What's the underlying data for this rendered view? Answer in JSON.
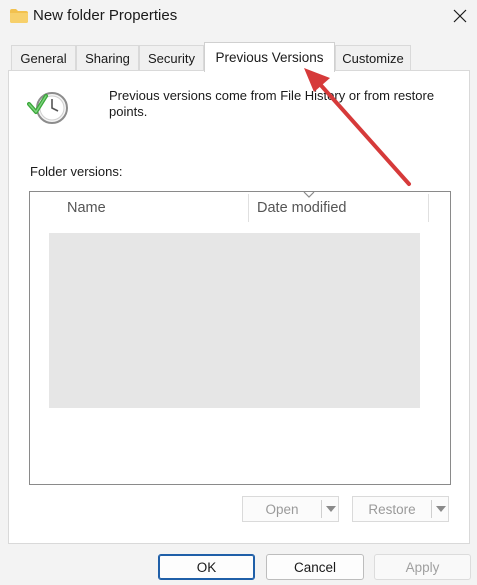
{
  "window": {
    "title": "New folder Properties",
    "icon": "folder-icon",
    "close_icon": "close-icon"
  },
  "tabs": [
    {
      "label": "General",
      "active": false
    },
    {
      "label": "Sharing",
      "active": false
    },
    {
      "label": "Security",
      "active": false
    },
    {
      "label": "Previous Versions",
      "active": true
    },
    {
      "label": "Customize",
      "active": false
    }
  ],
  "panel": {
    "info_icon": "history-clock-icon",
    "info_text": "Previous versions come from File History or from restore points.",
    "folder_versions_label": "Folder versions:",
    "columns": [
      "Name",
      "Date modified"
    ]
  },
  "actions": {
    "open_label": "Open",
    "restore_label": "Restore"
  },
  "footer": {
    "ok_label": "OK",
    "cancel_label": "Cancel",
    "apply_label": "Apply"
  },
  "annotation": {
    "color": "#d63a3a",
    "icon": "red-arrow-icon"
  }
}
